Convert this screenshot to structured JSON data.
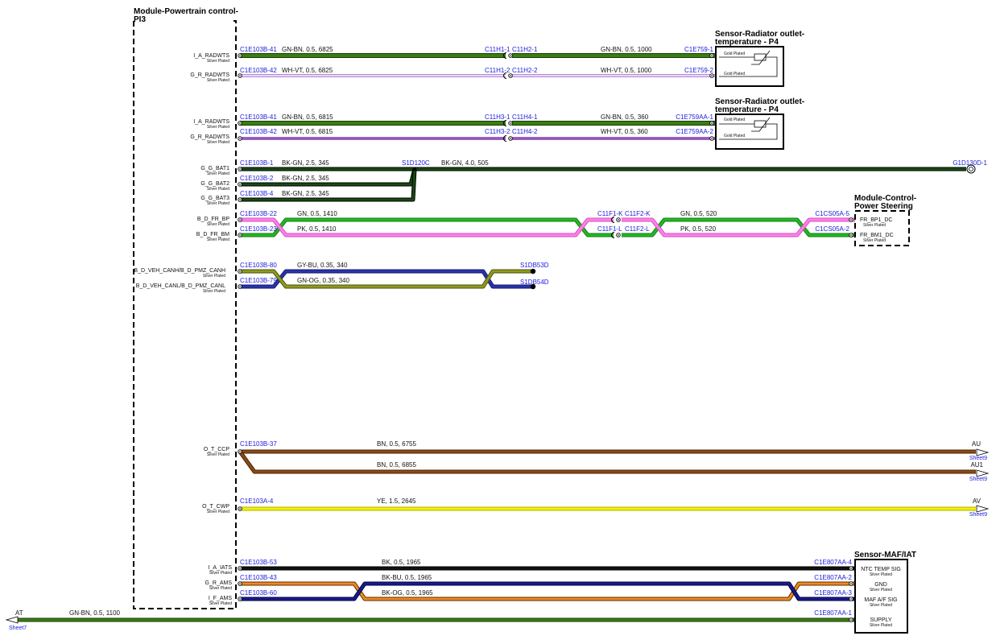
{
  "colors": {
    "GN-BN": "#3a7d12",
    "WH-VT": "#a060c8",
    "BK-GN": "#174a12",
    "GN": "#22b822",
    "PK": "#ff80e8",
    "GY-BU": "#8f9a1e",
    "GN-OG": "#2a34a8",
    "BN": "#8b4a12",
    "YE": "#f2f200",
    "BK": "#111111",
    "BK-BU": "#1a1a8a",
    "BK-OG": "#ee8a22",
    "connector": "#1a1adb"
  },
  "modules": {
    "pcm": {
      "title1": "Module-Powertrain control-",
      "title2": "PI3"
    },
    "rad1": {
      "title1": "Sensor-Radiator outlet-",
      "title2": "temperature - P4",
      "pin1": "Gold Plated",
      "pin2": "Gold Plated"
    },
    "rad2": {
      "title1": "Sensor-Radiator outlet-",
      "title2": "temperature - P4",
      "pin1": "Gold Plated",
      "pin2": "Gold Plated"
    },
    "ps": {
      "title1": "Module-Control-",
      "title2": "Power Steering",
      "pin1": "FR_BP1_DC",
      "pin2": "FR_BM1_DC",
      "sub": "Silver Plated"
    },
    "maf": {
      "title": "Sensor-MAF/IAT",
      "pins": [
        "NTC TEMP SIG",
        "GND",
        "MAF A/F SIG",
        "SUPPLY"
      ],
      "sub": "Silver Plated"
    }
  },
  "signals": [
    {
      "name": "I_A_RADWTS",
      "sub": "Silver Plated"
    },
    {
      "name": "G_R_RADWTS",
      "sub": "Silver Plated"
    },
    {
      "name": "I_A_RADWTS",
      "sub": "Silver Plated"
    },
    {
      "name": "G_R_RADWTS",
      "sub": "Silver Plated"
    },
    {
      "name": "G_G_BAT1",
      "sub": "Silver Plated"
    },
    {
      "name": "G_G_BAT2",
      "sub": "Silver Plated"
    },
    {
      "name": "G_G_BAT3",
      "sub": "Silver Plated"
    },
    {
      "name": "B_D_FR_BP",
      "sub": "Silver Plated"
    },
    {
      "name": "B_D_FR_BM",
      "sub": "Silver Plated"
    },
    {
      "name": "B_D_VEH_CANH/B_D_PMZ_CANH",
      "sub": "Silver Plated"
    },
    {
      "name": "B_D_VEH_CANL/B_D_PMZ_CANL",
      "sub": "Silver Plated"
    },
    {
      "name": "O_T_CCP",
      "sub": "Silver Plated"
    },
    {
      "name": "O_T_CWP",
      "sub": "Silver Plated"
    },
    {
      "name": "I_A_IATS",
      "sub": "Silver Plated"
    },
    {
      "name": "G_R_AMS",
      "sub": "Silver Plated"
    },
    {
      "name": "I_F_AMS",
      "sub": "Silver Plated"
    }
  ],
  "connectors": [
    "C1E103B-41",
    "C11H1-1",
    "C11H2-1",
    "C1E759-1",
    "C1E103B-42",
    "C11H1-2",
    "C11H2-2",
    "C1E759-2",
    "C1E103B-41",
    "C11H3-1",
    "C11H4-1",
    "C1E759AA-1",
    "C1E103B-42",
    "C11H3-2",
    "C11H4-2",
    "C1E759AA-2",
    "C1E103B-1",
    "S1D120C",
    "G1D130D-1",
    "C1E103B-2",
    "C1E103B-4",
    "C1E103B-22",
    "C11F1-K",
    "C11F2-K",
    "C1CS05A-5",
    "C1E103B-23",
    "C11F1-L",
    "C11F2-L",
    "C1CS05A-2",
    "C1E103B-80",
    "S1DB53D",
    "C1E103B-79",
    "S1DB54D",
    "C1E103B-37",
    "C1E103A-4",
    "C1E103B-53",
    "C1E807AA-4",
    "C1E103B-43",
    "C1E807AA-2",
    "C1E103B-60",
    "C1E807AA-3",
    "C1E807AA-1"
  ],
  "wires": [
    "GN-BN,  0.5,  6825",
    "GN-BN,  0.5,  1000",
    "WH-VT,  0.5,  6825",
    "WH-VT,  0.5,  1000",
    "GN-BN,  0.5,  6815",
    "GN-BN,  0.5,  360",
    "WH-VT,  0.5,  6815",
    "WH-VT,  0.5,  360",
    "BK-GN,  2.5,  345",
    "BK-GN,  4.0,  505",
    "BK-GN,  2.5,  345",
    "BK-GN,  2.5,  345",
    "GN,  0.5,  1410",
    "GN,  0.5,  520",
    "PK,  0.5,  1410",
    "PK,  0.5,  520",
    "GY-BU,  0.35,  340",
    "GN-OG,  0.35,  340",
    "BN,  0.5,  6755",
    "BN,  0.5,  6855",
    "YE,  1.5,  2645",
    "BK,  0.5,  1965",
    "BK-BU,  0.5,  1965",
    "BK-OG,  0.5,  1965",
    "GN-BN,  0.5,  1100"
  ],
  "offsheet": [
    {
      "label": "AU",
      "sheet": "Sheet9"
    },
    {
      "label": "AU1",
      "sheet": "Sheet9"
    },
    {
      "label": "AV",
      "sheet": "Sheet9"
    },
    {
      "label": "AT",
      "sheet": "Sheet7"
    }
  ]
}
